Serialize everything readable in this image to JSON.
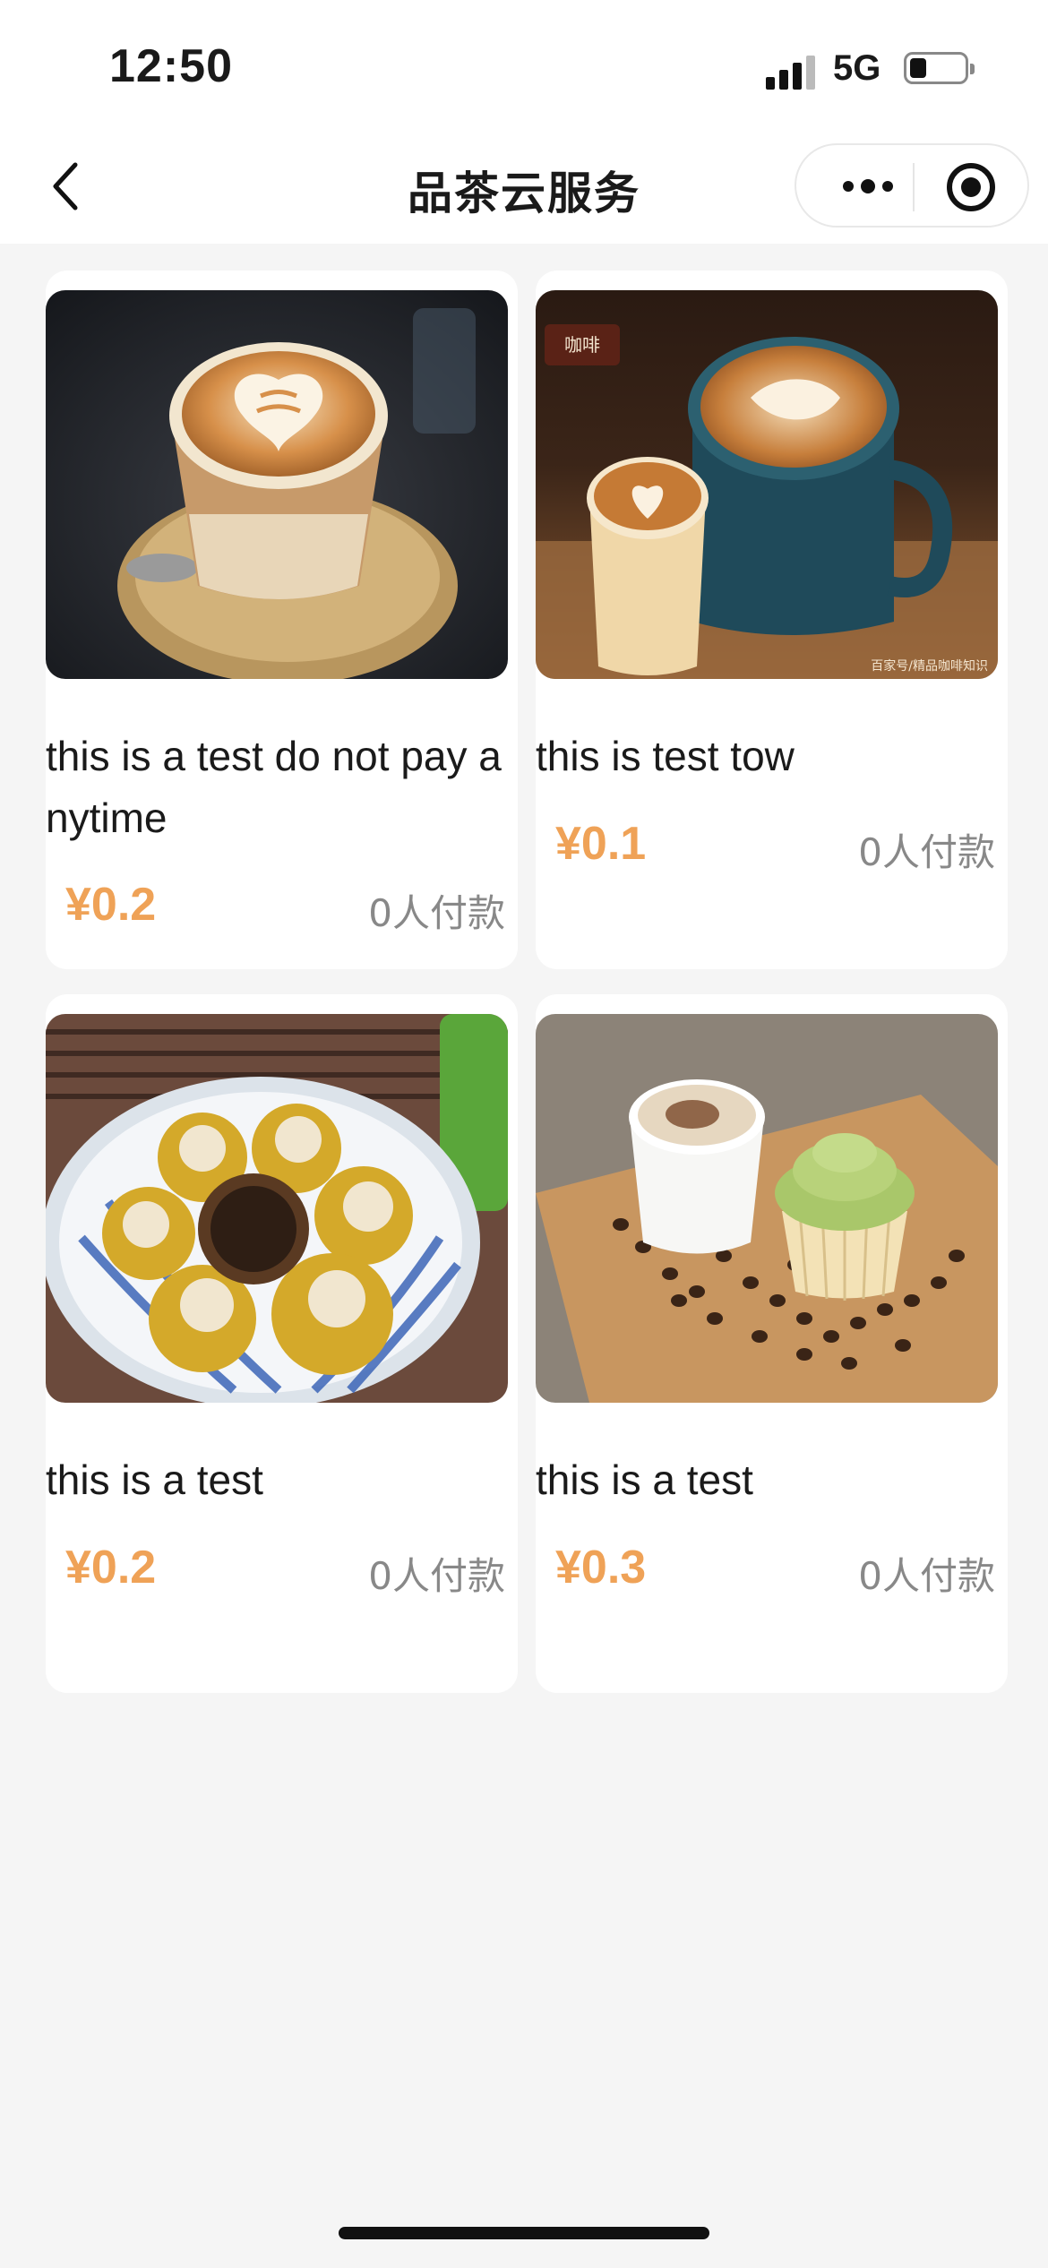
{
  "status_bar": {
    "time": "12:50",
    "network": "5G"
  },
  "nav": {
    "title": "品茶云服务"
  },
  "products": [
    {
      "name": "this is a test do not pay anytime",
      "price": "¥0.2",
      "sold": "0人付款",
      "image": "latte-art-glass-cup"
    },
    {
      "name": "this is test tow",
      "price": "¥0.1",
      "sold": "0人付款",
      "image": "latte-art-two-cups",
      "image_caption": "百家号/精品咖啡知识"
    },
    {
      "name": "this is a test",
      "price": "¥0.2",
      "sold": "0人付款",
      "image": "citrus-puer-tea-plate"
    },
    {
      "name": "this is a test",
      "price": "¥0.3",
      "sold": "0人付款",
      "image": "coffee-and-cupcake"
    }
  ],
  "colors": {
    "price": "#efa257",
    "page_background": "#f5f5f5",
    "card_background": "#ffffff"
  }
}
